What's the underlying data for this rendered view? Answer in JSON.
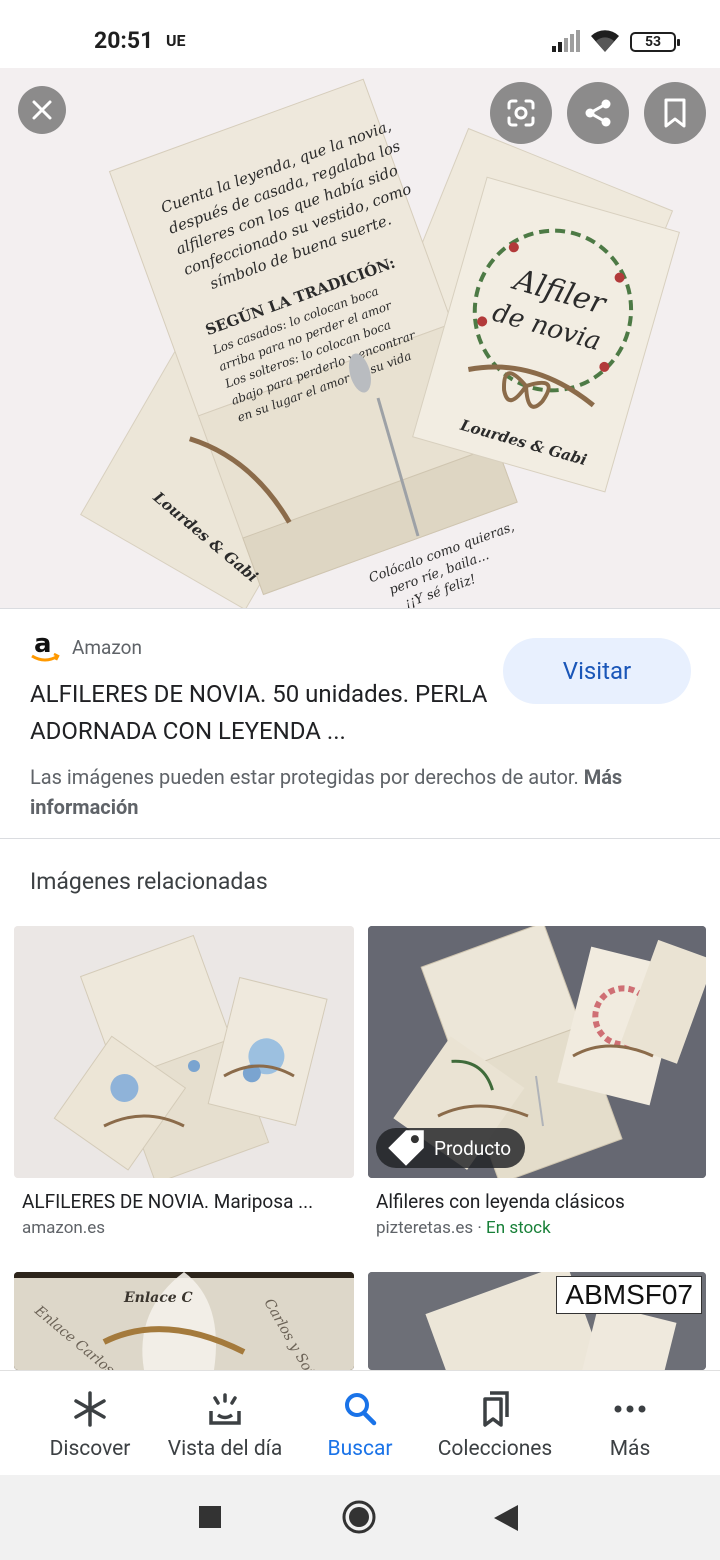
{
  "status_bar": {
    "time": "20:51",
    "carrier": "UE",
    "battery": "53"
  },
  "hero": {
    "card_text": {
      "legend_lines": [
        "Cuenta la leyenda, que la novia,",
        "después de casada, regalaba los",
        "alfileres con los que había sido",
        "confeccionado su vestido, como",
        "símbolo de buena suerte."
      ],
      "tradition_title": "SEGÚN LA TRADICIÓN:",
      "tradition_lines": [
        "Los casados: lo colocan boca",
        "arriba para no perder el amor",
        "Los solteros: lo colocan boca",
        "abajo para perderlo y encontrar",
        "en su lugar el amor de su vida"
      ],
      "card_title_1": "Alfiler",
      "card_title_2": "de novia",
      "names": "Lourdes & Gabi",
      "box_lines": [
        "Colócalo como quieras,",
        "pero ríe, baila...",
        "¡¡Y sé feliz!"
      ]
    }
  },
  "info": {
    "source": "Amazon",
    "visit": "Visitar",
    "title": "ALFILERES DE NOVIA. 50 unidades. PERLA ADORNADA CON LEYENDA ...",
    "copyright": "Las imágenes pueden estar protegidas por derechos de autor.",
    "more_info": "Más información"
  },
  "related": {
    "heading": "Imágenes relacionadas",
    "items": [
      {
        "title": "ALFILERES DE NOVIA. Mariposa ...",
        "site": "amazon.es",
        "stock": ""
      },
      {
        "title": "Alfileres con leyenda clásicos",
        "site": "pizteretas.es",
        "separator": " · ",
        "stock": "En stock",
        "badge": "Producto"
      },
      {
        "title": "",
        "site": ""
      },
      {
        "title": "",
        "site": "",
        "code": "ABMSF07"
      }
    ]
  },
  "bottom_nav": [
    {
      "label": "Discover"
    },
    {
      "label": "Vista del día"
    },
    {
      "label": "Buscar"
    },
    {
      "label": "Colecciones"
    },
    {
      "label": "Más"
    }
  ],
  "colors": {
    "accent": "#1a73e8",
    "stock": "#188038",
    "visit_bg": "#e8f0fe"
  }
}
